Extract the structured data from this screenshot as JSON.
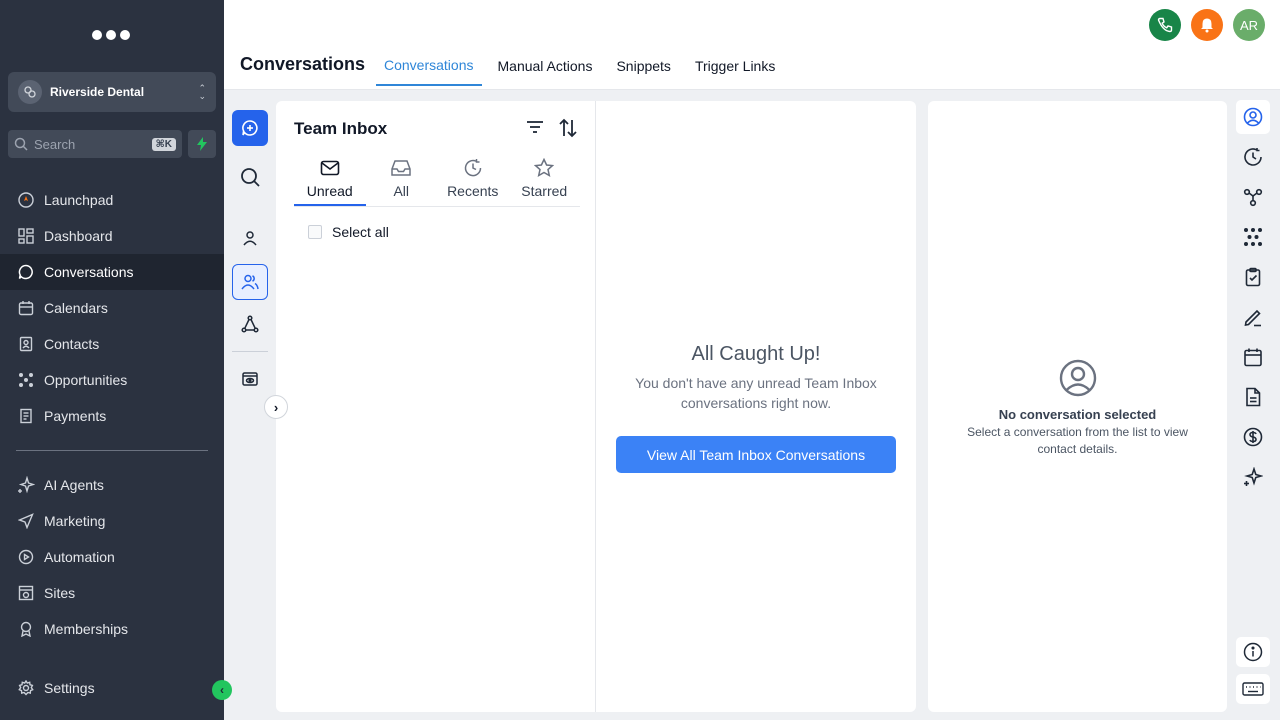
{
  "sidebar": {
    "account_name": "Riverside Dental",
    "search_placeholder": "Search",
    "search_shortcut": "⌘K",
    "items": [
      {
        "label": "Launchpad",
        "icon": "rocket-icon"
      },
      {
        "label": "Dashboard",
        "icon": "grid-icon"
      },
      {
        "label": "Conversations",
        "icon": "chat-bubble-icon",
        "active": true
      },
      {
        "label": "Calendars",
        "icon": "calendar-icon"
      },
      {
        "label": "Contacts",
        "icon": "address-book-icon"
      },
      {
        "label": "Opportunities",
        "icon": "network-icon"
      },
      {
        "label": "Payments",
        "icon": "receipt-icon"
      }
    ],
    "items2": [
      {
        "label": "AI Agents",
        "icon": "sparkle-icon"
      },
      {
        "label": "Marketing",
        "icon": "send-icon"
      },
      {
        "label": "Automation",
        "icon": "play-circle-icon"
      },
      {
        "label": "Sites",
        "icon": "globe-window-icon"
      },
      {
        "label": "Memberships",
        "icon": "badge-icon"
      }
    ],
    "settings_label": "Settings"
  },
  "header": {
    "title": "Conversations",
    "tabs": [
      "Conversations",
      "Manual Actions",
      "Snippets",
      "Trigger Links"
    ],
    "avatar_initials": "AR"
  },
  "list": {
    "title": "Team Inbox",
    "filters": [
      "Unread",
      "All",
      "Recents",
      "Starred"
    ],
    "select_all": "Select all"
  },
  "empty": {
    "title": "All Caught Up!",
    "text": "You don't have any unread Team Inbox conversations right now.",
    "button": "View All Team Inbox Conversations"
  },
  "detail": {
    "title": "No conversation selected",
    "text": "Select a conversation from the list to view contact details."
  },
  "colors": {
    "sidebar_bg": "#2b3240",
    "accent": "#2563eb",
    "tab_active": "#2f86d8",
    "phone": "#188548",
    "bell": "#f97316",
    "avatar": "#6aad6a"
  }
}
